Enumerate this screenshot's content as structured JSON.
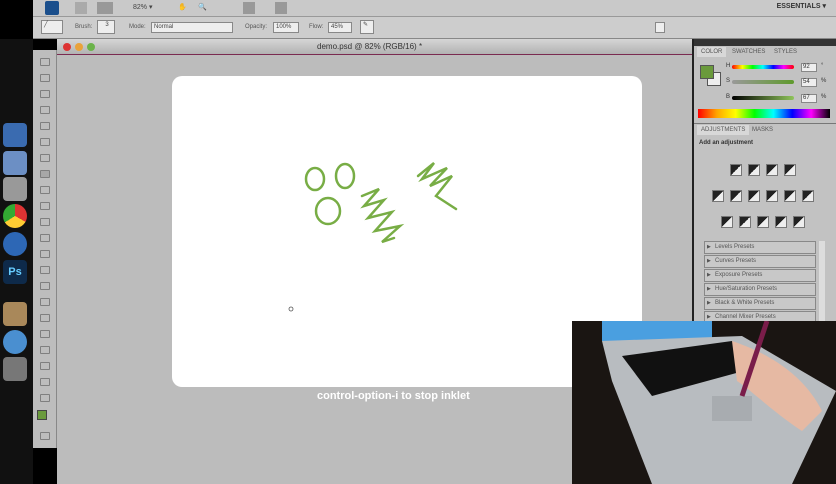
{
  "app_bar": {
    "zoom": "82%",
    "workspace": "ESSENTIALS"
  },
  "options_bar": {
    "brush_label": "Brush:",
    "brush_size": "3",
    "mode_label": "Mode:",
    "mode_value": "Normal",
    "opacity_label": "Opacity:",
    "opacity_value": "100%",
    "flow_label": "Flow:",
    "flow_value": "45%"
  },
  "document": {
    "title": "demo.psd @ 82% (RGB/16) *"
  },
  "caption": "control-option-i to stop inklet",
  "color_panel": {
    "tabs": [
      "COLOR",
      "SWATCHES",
      "STYLES"
    ],
    "h_label": "H",
    "s_label": "S",
    "b_label": "B",
    "h": "92",
    "s": "54",
    "b": "67",
    "pct": "%",
    "deg": "°",
    "foreground": "#6a9a3c"
  },
  "adjustments_panel": {
    "tabs": [
      "ADJUSTMENTS",
      "MASKS"
    ],
    "heading": "Add an adjustment",
    "presets": [
      "Levels Presets",
      "Curves Presets",
      "Exposure Presets",
      "Hue/Saturation Presets",
      "Black & White Presets",
      "Channel Mixer Presets"
    ]
  },
  "stroke_color": "#78ad45"
}
